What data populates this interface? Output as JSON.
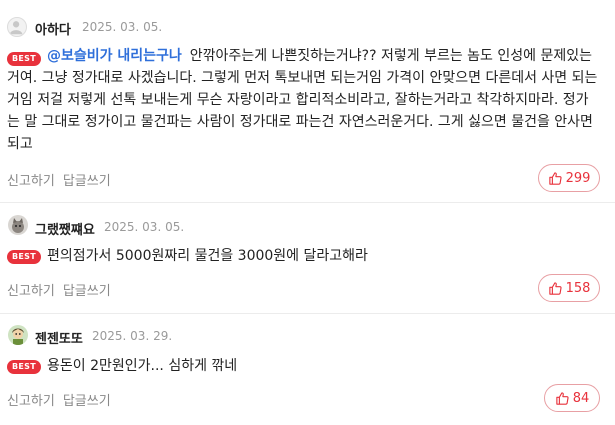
{
  "comments": [
    {
      "username": "아하다",
      "date": "2025. 03. 05.",
      "badge": "BEST",
      "mention": "@보슬비가 내리는구나",
      "text": "안깎아주는게 나쁜짓하는거냐?? 저렇게 부르는 놈도 인성에 문제있는거여. 그냥 정가대로 사겠습니다. 그렇게 먼저 톡보내면 되는거임 가격이 안맞으면 다른데서 사면 되는거임 저걸 저렇게 선톡 보내는게 무슨 자랑이라고 합리적소비라고, 잘하는거라고 착각하지마라. 정가는 말 그대로 정가이고 물건파는 사람이 정가대로 파는건 자연스러운거다. 그게 싫으면 물건을 안사면되고",
      "report_label": "신고하기",
      "reply_label": "답글쓰기",
      "likes": "299",
      "avatar_icon": "default-user-icon"
    },
    {
      "username": "그랬쨌쨰요",
      "date": "2025. 03. 05.",
      "badge": "BEST",
      "text": "편의점가서 5000원짜리 물건을 3000원에 달라고해라",
      "report_label": "신고하기",
      "reply_label": "답글쓰기",
      "likes": "158",
      "avatar_icon": "cat-avatar-icon"
    },
    {
      "username": "젠젠또또",
      "date": "2025. 03. 29.",
      "badge": "BEST",
      "text": "용돈이 2만원인가... 심하게 깎네",
      "report_label": "신고하기",
      "reply_label": "답글쓰기",
      "likes": "84",
      "avatar_icon": "character-avatar-icon"
    }
  ],
  "colors": {
    "best_badge": "#e8323c",
    "mention": "#2f6fda",
    "like": "#e8323c"
  }
}
